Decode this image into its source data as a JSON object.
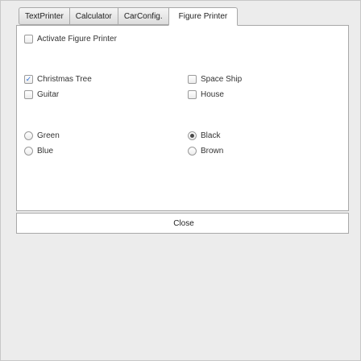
{
  "tabs": [
    {
      "label": "TextPrinter"
    },
    {
      "label": "Calculator"
    },
    {
      "label": "CarConfig."
    },
    {
      "label": "Figure Printer"
    }
  ],
  "panel": {
    "activate": {
      "label": "Activate Figure Printer",
      "checked": false
    },
    "figures": [
      {
        "label": "Christmas Tree",
        "checked": true
      },
      {
        "label": "Guitar",
        "checked": false
      },
      {
        "label": "Space Ship",
        "checked": false
      },
      {
        "label": "House",
        "checked": false
      }
    ],
    "colors": [
      {
        "label": "Green",
        "selected": false
      },
      {
        "label": "Blue",
        "selected": false
      },
      {
        "label": "Black",
        "selected": true
      },
      {
        "label": "Brown",
        "selected": false
      }
    ]
  },
  "close_label": "Close"
}
